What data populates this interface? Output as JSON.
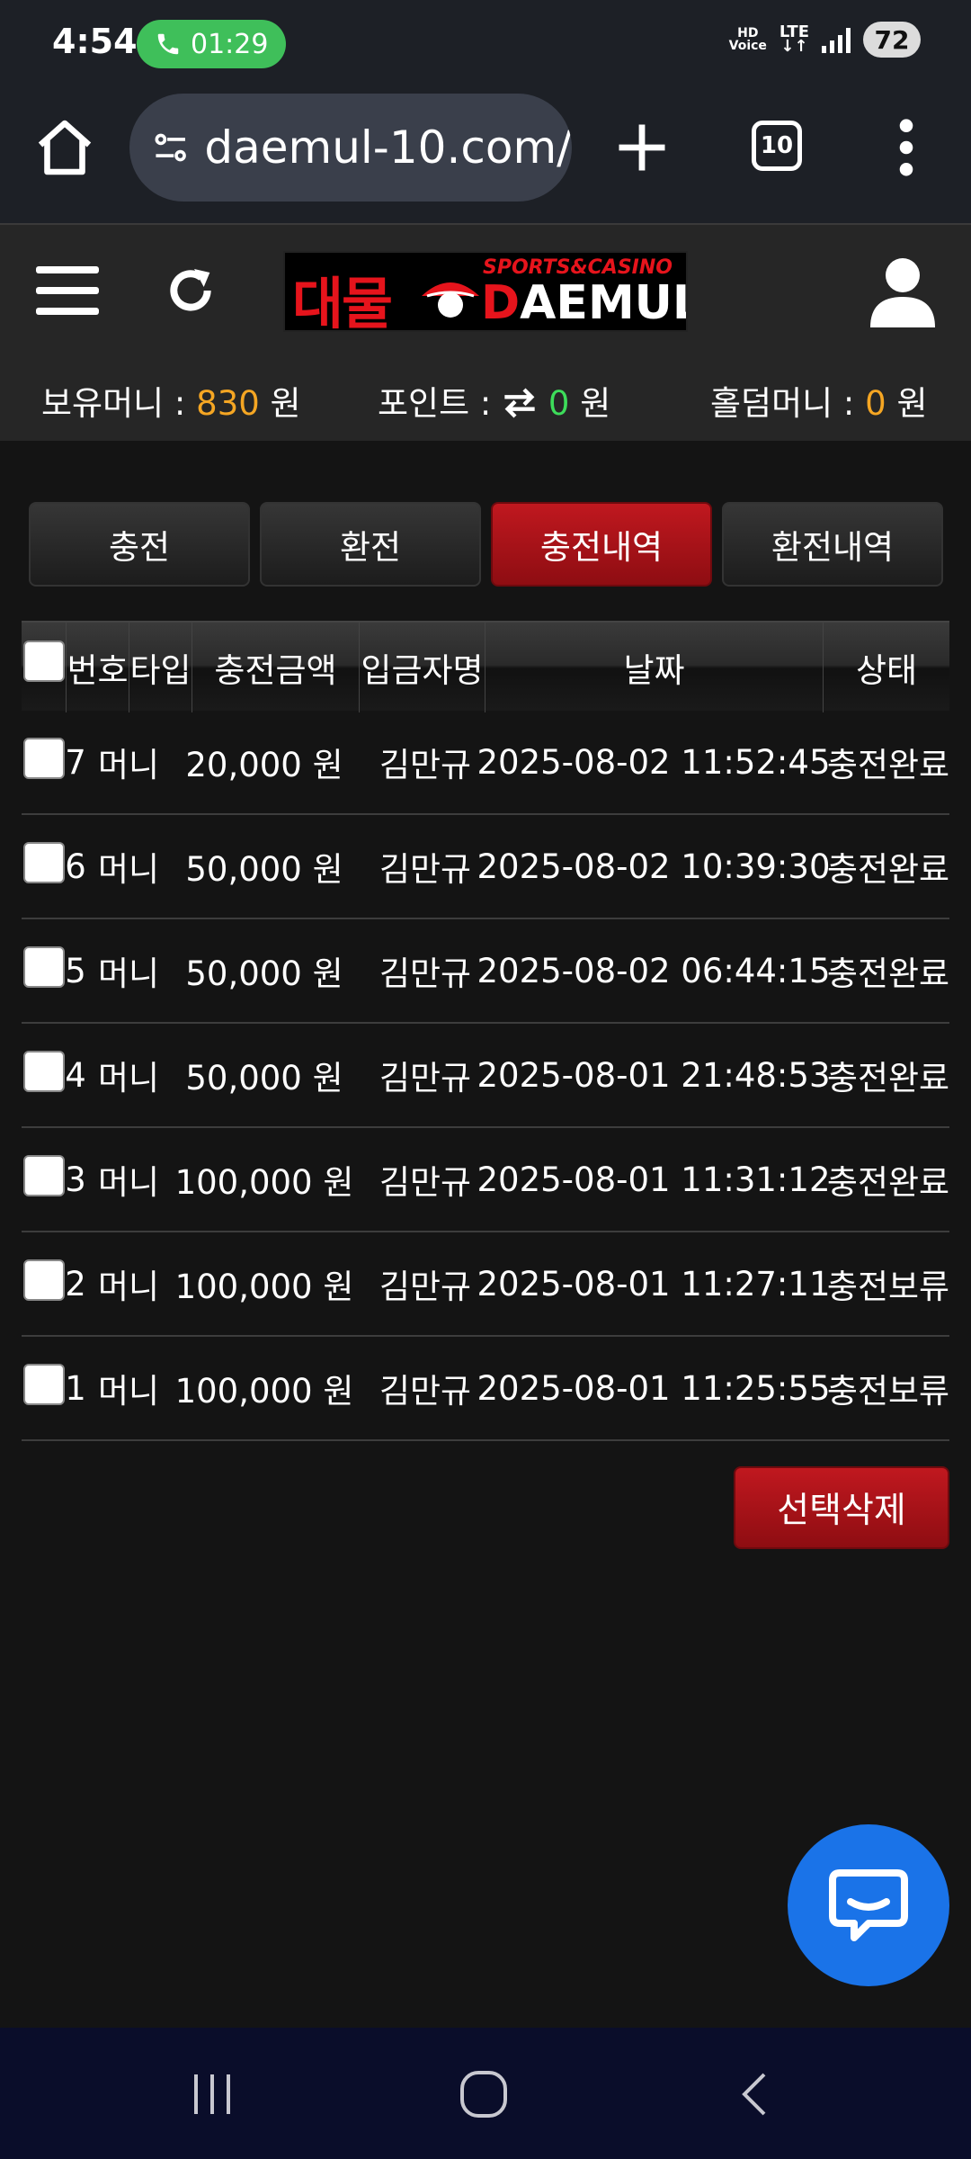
{
  "status": {
    "time": "4:54",
    "call_timer": "01:29",
    "hd_label": "HD\nVoice",
    "lte_label": "LTE",
    "battery": "72"
  },
  "browser": {
    "url": "daemul-10.com/",
    "tab_count": "10"
  },
  "site": {
    "logo_korean": "대물",
    "logo_sub": "SPORTS&CASINO",
    "logo_english_first": "D",
    "logo_english_rest": "AEMUL"
  },
  "balance": {
    "money_label": "보유머니 :",
    "money_value": "830",
    "money_unit": "원",
    "point_label": "포인트 :",
    "point_value": "0",
    "point_unit": "원",
    "holdem_label": "홀덤머니 :",
    "holdem_value": "0",
    "holdem_unit": "원"
  },
  "tabs": [
    {
      "label": "충전"
    },
    {
      "label": "환전"
    },
    {
      "label": "충전내역"
    },
    {
      "label": "환전내역"
    }
  ],
  "active_tab": 2,
  "table": {
    "headers": [
      "번호",
      "타입",
      "충전금액",
      "입금자명",
      "날짜",
      "상태"
    ],
    "rows": [
      {
        "no": "7",
        "type": "머니",
        "amount": "20,000 원",
        "depositor": "김만규",
        "date": "2025-08-02 11:52:45",
        "status": "충전완료"
      },
      {
        "no": "6",
        "type": "머니",
        "amount": "50,000 원",
        "depositor": "김만규",
        "date": "2025-08-02 10:39:30",
        "status": "충전완료"
      },
      {
        "no": "5",
        "type": "머니",
        "amount": "50,000 원",
        "depositor": "김만규",
        "date": "2025-08-02 06:44:15",
        "status": "충전완료"
      },
      {
        "no": "4",
        "type": "머니",
        "amount": "50,000 원",
        "depositor": "김만규",
        "date": "2025-08-01 21:48:53",
        "status": "충전완료"
      },
      {
        "no": "3",
        "type": "머니",
        "amount": "100,000 원",
        "depositor": "김만규",
        "date": "2025-08-01 11:31:12",
        "status": "충전완료"
      },
      {
        "no": "2",
        "type": "머니",
        "amount": "100,000 원",
        "depositor": "김만규",
        "date": "2025-08-01 11:27:11",
        "status": "충전보류"
      },
      {
        "no": "1",
        "type": "머니",
        "amount": "100,000 원",
        "depositor": "김만규",
        "date": "2025-08-01 11:25:55",
        "status": "충전보류"
      }
    ]
  },
  "actions": {
    "delete_selected": "선택삭제"
  },
  "colors": {
    "accent_red": "#c0181f",
    "money_orange": "#f5a623",
    "point_green": "#3ddc5a",
    "chat_blue": "#1a73e8"
  },
  "icons": [
    "home-icon",
    "site-settings-icon",
    "plus-icon",
    "more-vert-icon",
    "hamburger-icon",
    "refresh-icon",
    "user-icon",
    "transfer-icon",
    "chat-icon",
    "recent-apps-icon",
    "home-nav-icon",
    "back-icon"
  ]
}
